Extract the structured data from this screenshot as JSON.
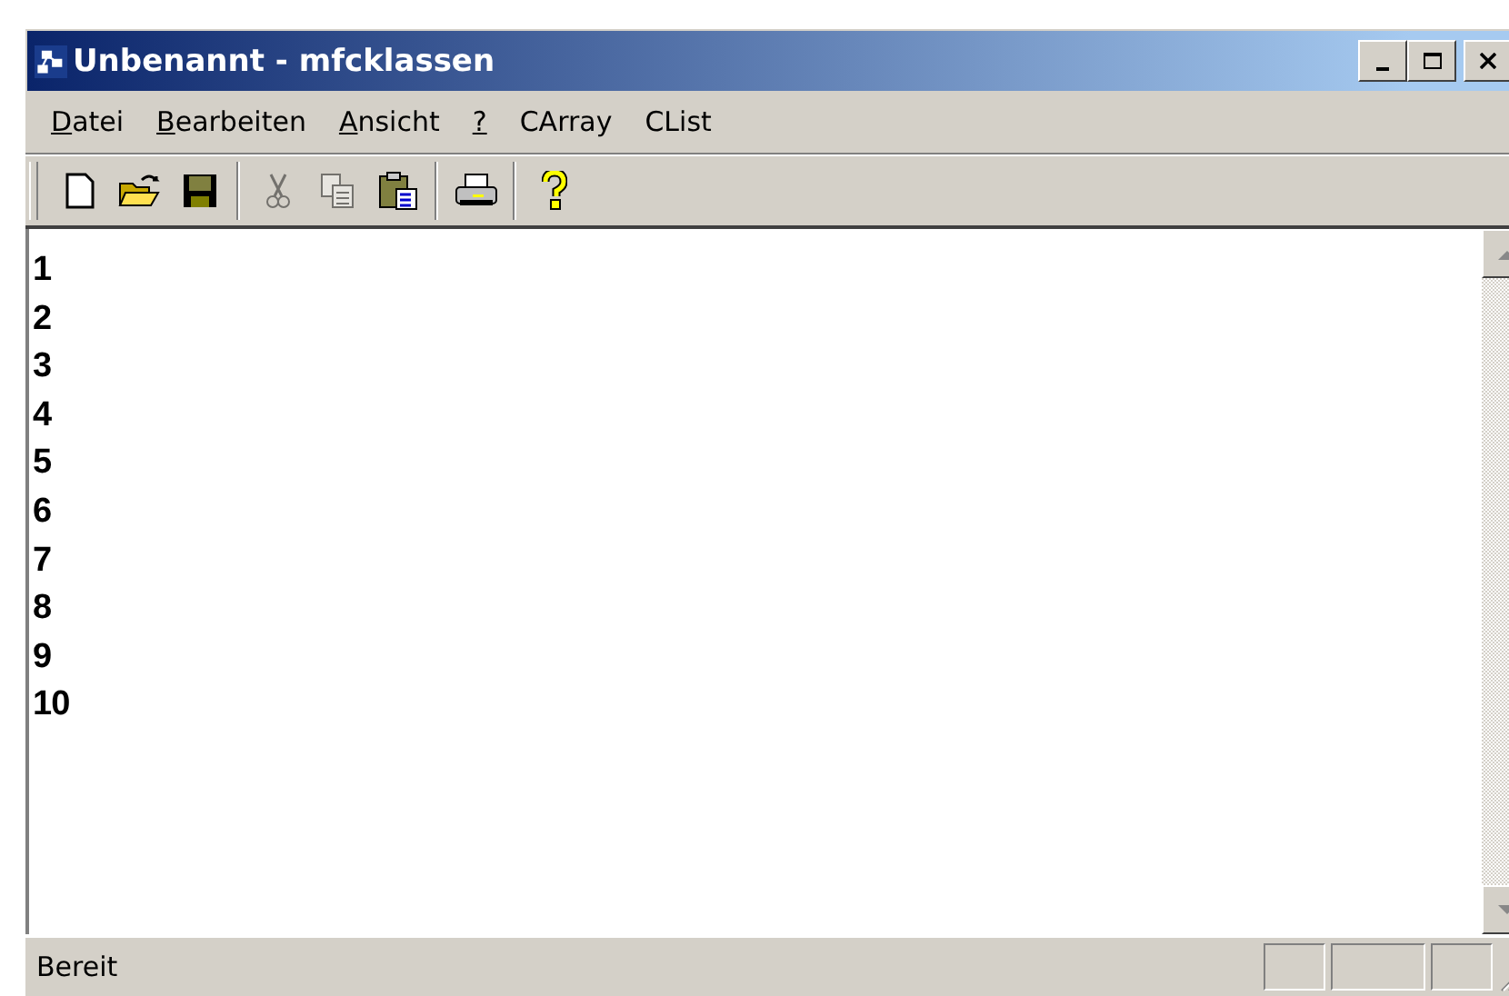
{
  "window": {
    "title": "Unbenannt - mfcklassen"
  },
  "menu": [
    {
      "label": "Datei",
      "first_letter_underlined": true
    },
    {
      "label": "Bearbeiten",
      "first_letter_underlined": true
    },
    {
      "label": "Ansicht",
      "first_letter_underlined": true
    },
    {
      "label": "?",
      "first_letter_underlined": true
    },
    {
      "label": "CArray",
      "first_letter_underlined": false
    },
    {
      "label": "CList",
      "first_letter_underlined": false
    }
  ],
  "toolbar": [
    [
      {
        "kind": "new",
        "disabled": false
      },
      {
        "kind": "open",
        "disabled": false
      },
      {
        "kind": "save",
        "disabled": false
      }
    ],
    [
      {
        "kind": "cut",
        "disabled": true
      },
      {
        "kind": "copy",
        "disabled": true
      },
      {
        "kind": "paste",
        "disabled": false
      }
    ],
    [
      {
        "kind": "print",
        "disabled": false
      }
    ],
    [
      {
        "kind": "help",
        "disabled": false
      }
    ]
  ],
  "document": {
    "lines": [
      "1",
      "2",
      "3",
      "4",
      "5",
      "6",
      "7",
      "8",
      "9",
      "10"
    ]
  },
  "status_bar": {
    "text": "Bereit"
  }
}
